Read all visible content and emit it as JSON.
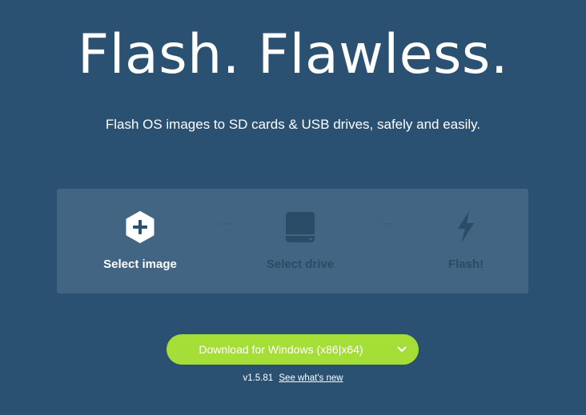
{
  "hero": {
    "title": "Flash. Flawless.",
    "subtitle": "Flash OS images to SD cards & USB drives, safely and easily."
  },
  "steps": [
    {
      "label": "Select image",
      "icon": "plus-hexagon-icon",
      "state": "active"
    },
    {
      "label": "Select drive",
      "icon": "hard-drive-icon",
      "state": "disabled"
    },
    {
      "label": "Flash!",
      "icon": "lightning-bolt-icon",
      "state": "disabled"
    }
  ],
  "download": {
    "label": "Download for Windows (x86|x64)",
    "dropdown_icon": "chevron-down-icon"
  },
  "version": {
    "number": "v1.5.81",
    "whats_new": "See what's new"
  },
  "colors": {
    "background": "#2b5172",
    "panel": "#416582",
    "accent_green": "#a5de37",
    "disabled": "#2c4b66"
  }
}
